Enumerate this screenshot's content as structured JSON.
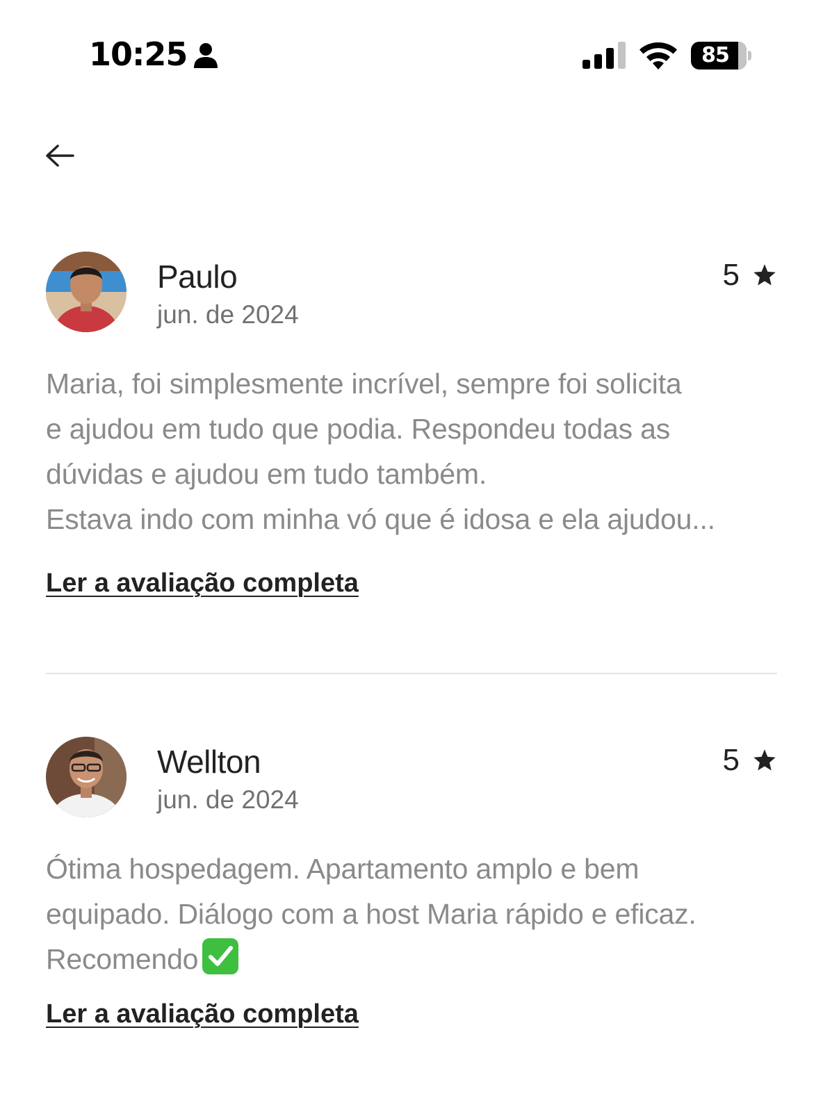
{
  "status_bar": {
    "time": "10:25",
    "battery_level": "85",
    "person_icon": "person-fill-icon",
    "signal_icon": "cellular-signal-icon",
    "wifi_icon": "wifi-icon",
    "battery_icon": "battery-icon"
  },
  "navigation": {
    "back_icon": "arrow-left-icon"
  },
  "reviews": [
    {
      "name": "Paulo",
      "date": "jun. de 2024",
      "rating": "5",
      "text": "Maria, foi simplesmente incrível, sempre foi solicita\ne ajudou em tudo que podia. Respondeu todas as\ndúvidas e ajudou em tudo também.\nEstava indo com minha vó que é idosa e ela ajudou...",
      "read_more": "Ler a avaliação completa"
    },
    {
      "name": "Wellton",
      "date": "jun. de 2024",
      "rating": "5",
      "text": "Ótima hospedagem. Apartamento amplo e bem\nequipado. Diálogo com a host Maria rápido e eficaz.\nRecomendo",
      "read_more": "Ler a avaliação completa",
      "emoji_icon": "check-mark-button-icon"
    }
  ],
  "colors": {
    "primary_text": "#222222",
    "secondary_text": "#717171",
    "body_text": "#8a8a8a",
    "divider": "#e4e4e4",
    "check_green": "#3fbf3f"
  }
}
